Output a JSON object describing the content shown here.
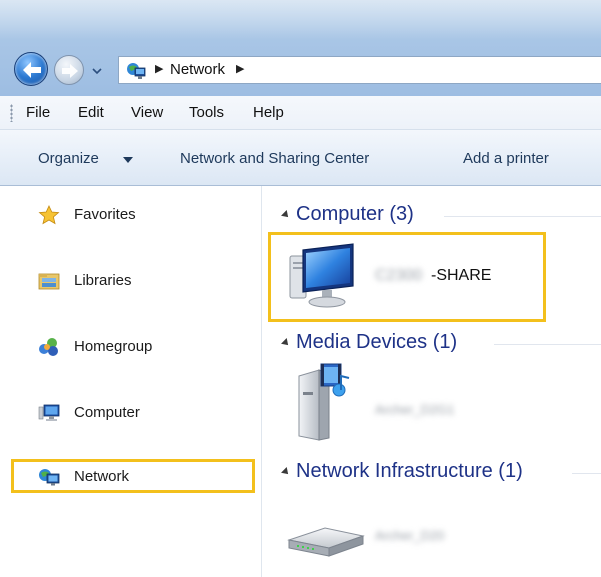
{
  "address_bar": {
    "crumbs": [
      "Network"
    ],
    "icons": [
      "back-arrow-icon",
      "forward-arrow-icon",
      "recent-pages-chevron-icon",
      "network-icon",
      "breadcrumb-separator-icon"
    ]
  },
  "menu_bar": {
    "items": [
      "File",
      "Edit",
      "View",
      "Tools",
      "Help"
    ]
  },
  "command_bar": {
    "organize": "Organize",
    "network_sharing": "Network and Sharing Center",
    "add_printer": "Add a printer"
  },
  "nav_pane": {
    "items": [
      {
        "label": "Favorites",
        "icon": "star-icon"
      },
      {
        "label": "Libraries",
        "icon": "libraries-icon"
      },
      {
        "label": "Homegroup",
        "icon": "homegroup-icon"
      },
      {
        "label": "Computer",
        "icon": "computer-icon"
      },
      {
        "label": "Network",
        "icon": "network-icon",
        "selected": true
      }
    ]
  },
  "content": {
    "groups": [
      {
        "title": "Computer (3)",
        "devices": [
          {
            "name_blurred": "C2300",
            "name_suffix": "-SHARE",
            "icon": "computer-monitor-icon",
            "highlighted": true
          }
        ]
      },
      {
        "title": "Media Devices (1)",
        "devices": [
          {
            "name_blurred": "Archer_D2G1",
            "icon": "media-device-icon"
          }
        ]
      },
      {
        "title": "Network Infrastructure (1)",
        "devices": [
          {
            "name_blurred": "Archer_D20",
            "icon": "router-icon"
          }
        ]
      }
    ]
  },
  "colors": {
    "highlight_border": "#f3c01c",
    "group_header_text": "#1e3287",
    "command_text": "#1e395b",
    "titlebar": "#a9c6e6"
  }
}
